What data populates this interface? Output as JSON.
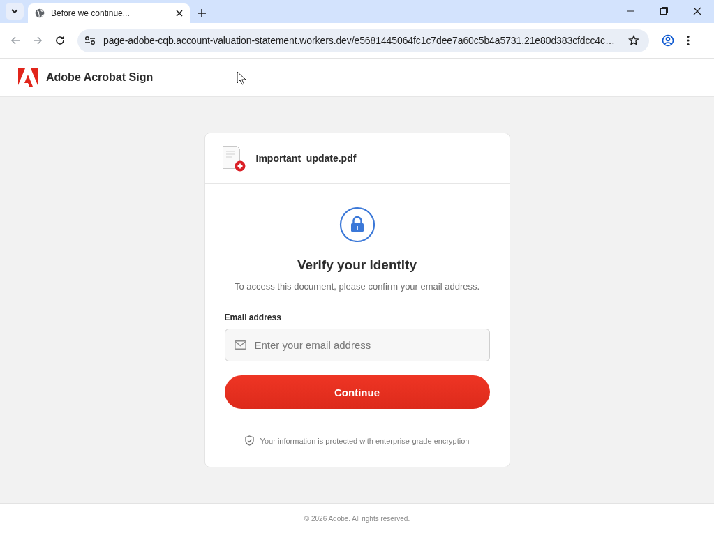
{
  "browser": {
    "tabs": [
      {
        "title": "Before we continue...",
        "selected": true
      }
    ],
    "url": "page-adobe-cqb.account-valuation-statement.workers.dev/e5681445064fc1c7dee7a60c5b4a5731.21e80d383cfdcc4c…"
  },
  "header": {
    "brand": "Adobe Acrobat Sign"
  },
  "document": {
    "file_name": "Important_update.pdf"
  },
  "verify": {
    "title": "Verify your identity",
    "subtitle": "To access this document, please confirm your email address.",
    "email_field": {
      "label": "Email address",
      "placeholder": "Enter your email address"
    },
    "button": "Continue",
    "security_note": "Your information is protected with enterprise-grade encryption"
  },
  "footer": {
    "copyright": "© 2026 Adobe. All rights reserved."
  }
}
